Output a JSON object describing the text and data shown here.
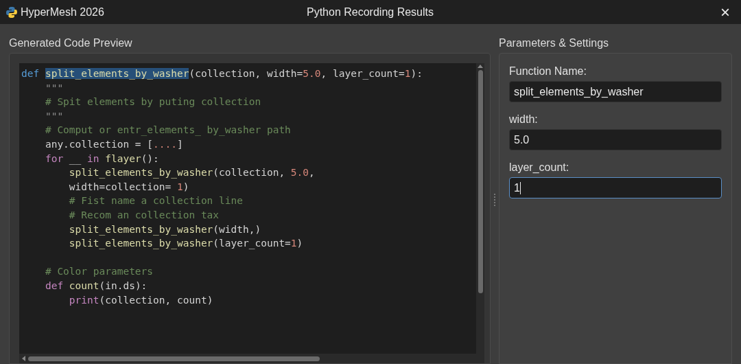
{
  "window": {
    "app": "HyperMesh 2026",
    "title": "Python Recording Results",
    "close": "×"
  },
  "code_panel": {
    "title": "Generated Code Preview",
    "lines": [
      {
        "gap_before": false,
        "tokens": [
          {
            "text": "def ",
            "kind": "keyword",
            "selected": false
          },
          {
            "text": "split_elements_by_washer",
            "kind": "function",
            "selected": true
          },
          {
            "text": "(collection, width=",
            "kind": "plain",
            "selected": false
          },
          {
            "text": "5.0",
            "kind": "number",
            "selected": false
          },
          {
            "text": ", layer_count=",
            "kind": "plain",
            "selected": false
          },
          {
            "text": "1",
            "kind": "number",
            "selected": false
          },
          {
            "text": "):",
            "kind": "plain",
            "selected": false
          }
        ]
      },
      {
        "gap_before": false,
        "tokens": [
          {
            "text": "    \"\"\"",
            "kind": "string",
            "selected": false
          }
        ]
      },
      {
        "gap_before": false,
        "tokens": [
          {
            "text": "    # Spit elements by puting collection",
            "kind": "comment",
            "selected": false
          }
        ]
      },
      {
        "gap_before": false,
        "tokens": [
          {
            "text": "    \"\"\"",
            "kind": "string",
            "selected": false
          }
        ]
      },
      {
        "gap_before": false,
        "tokens": [
          {
            "text": "    # Comput or entr_elements_ by_washer path",
            "kind": "comment",
            "selected": false
          }
        ]
      },
      {
        "gap_before": false,
        "tokens": [
          {
            "text": "    any.collection = [",
            "kind": "plain",
            "selected": false
          },
          {
            "text": "....",
            "kind": "number",
            "selected": false
          },
          {
            "text": "]",
            "kind": "plain",
            "selected": false
          }
        ]
      },
      {
        "gap_before": false,
        "tokens": [
          {
            "text": "    for",
            "kind": "control",
            "selected": false
          },
          {
            "text": " __ ",
            "kind": "plain",
            "selected": false
          },
          {
            "text": "in ",
            "kind": "control",
            "selected": false
          },
          {
            "text": "flayer",
            "kind": "function",
            "selected": false
          },
          {
            "text": "():",
            "kind": "plain",
            "selected": false
          }
        ]
      },
      {
        "gap_before": false,
        "tokens": [
          {
            "text": "        split_elements_by_washer",
            "kind": "function",
            "selected": false
          },
          {
            "text": "(collection, ",
            "kind": "plain",
            "selected": false
          },
          {
            "text": "5.0",
            "kind": "number",
            "selected": false
          },
          {
            "text": ",",
            "kind": "plain",
            "selected": false
          }
        ]
      },
      {
        "gap_before": false,
        "tokens": [
          {
            "text": "        width=collection= ",
            "kind": "plain",
            "selected": false
          },
          {
            "text": "1",
            "kind": "number",
            "selected": false
          },
          {
            "text": ")",
            "kind": "plain",
            "selected": false
          }
        ]
      },
      {
        "gap_before": false,
        "tokens": [
          {
            "text": "        # Fist name a collection line",
            "kind": "comment",
            "selected": false
          }
        ]
      },
      {
        "gap_before": false,
        "tokens": [
          {
            "text": "        # Recom an collection tax",
            "kind": "comment",
            "selected": false
          }
        ]
      },
      {
        "gap_before": false,
        "tokens": [
          {
            "text": "        split_elements_by_washer",
            "kind": "function",
            "selected": false
          },
          {
            "text": "(width,)",
            "kind": "plain",
            "selected": false
          }
        ]
      },
      {
        "gap_before": false,
        "tokens": [
          {
            "text": "        split_elements_by_washer",
            "kind": "function",
            "selected": false
          },
          {
            "text": "(layer_count=",
            "kind": "plain",
            "selected": false
          },
          {
            "text": "1",
            "kind": "number",
            "selected": false
          },
          {
            "text": ")",
            "kind": "plain",
            "selected": false
          }
        ]
      },
      {
        "gap_before": true,
        "tokens": [
          {
            "text": "    # Color parameters",
            "kind": "comment",
            "selected": false
          }
        ]
      },
      {
        "gap_before": false,
        "tokens": [
          {
            "text": "    def ",
            "kind": "control",
            "selected": false
          },
          {
            "text": "count",
            "kind": "function",
            "selected": false
          },
          {
            "text": "(in.ds):",
            "kind": "plain",
            "selected": false
          }
        ]
      },
      {
        "gap_before": false,
        "tokens": [
          {
            "text": "        print",
            "kind": "control",
            "selected": false
          },
          {
            "text": "(collection, count)",
            "kind": "plain",
            "selected": false
          }
        ]
      }
    ]
  },
  "settings_panel": {
    "title": "Parameters & Settings",
    "fields": [
      {
        "label": "Function Name:",
        "value": "split_elements_by_washer",
        "focused": false
      },
      {
        "label": "width:",
        "value": "5.0",
        "focused": false
      },
      {
        "label": "layer_count:",
        "value": "1",
        "focused": true
      }
    ]
  }
}
